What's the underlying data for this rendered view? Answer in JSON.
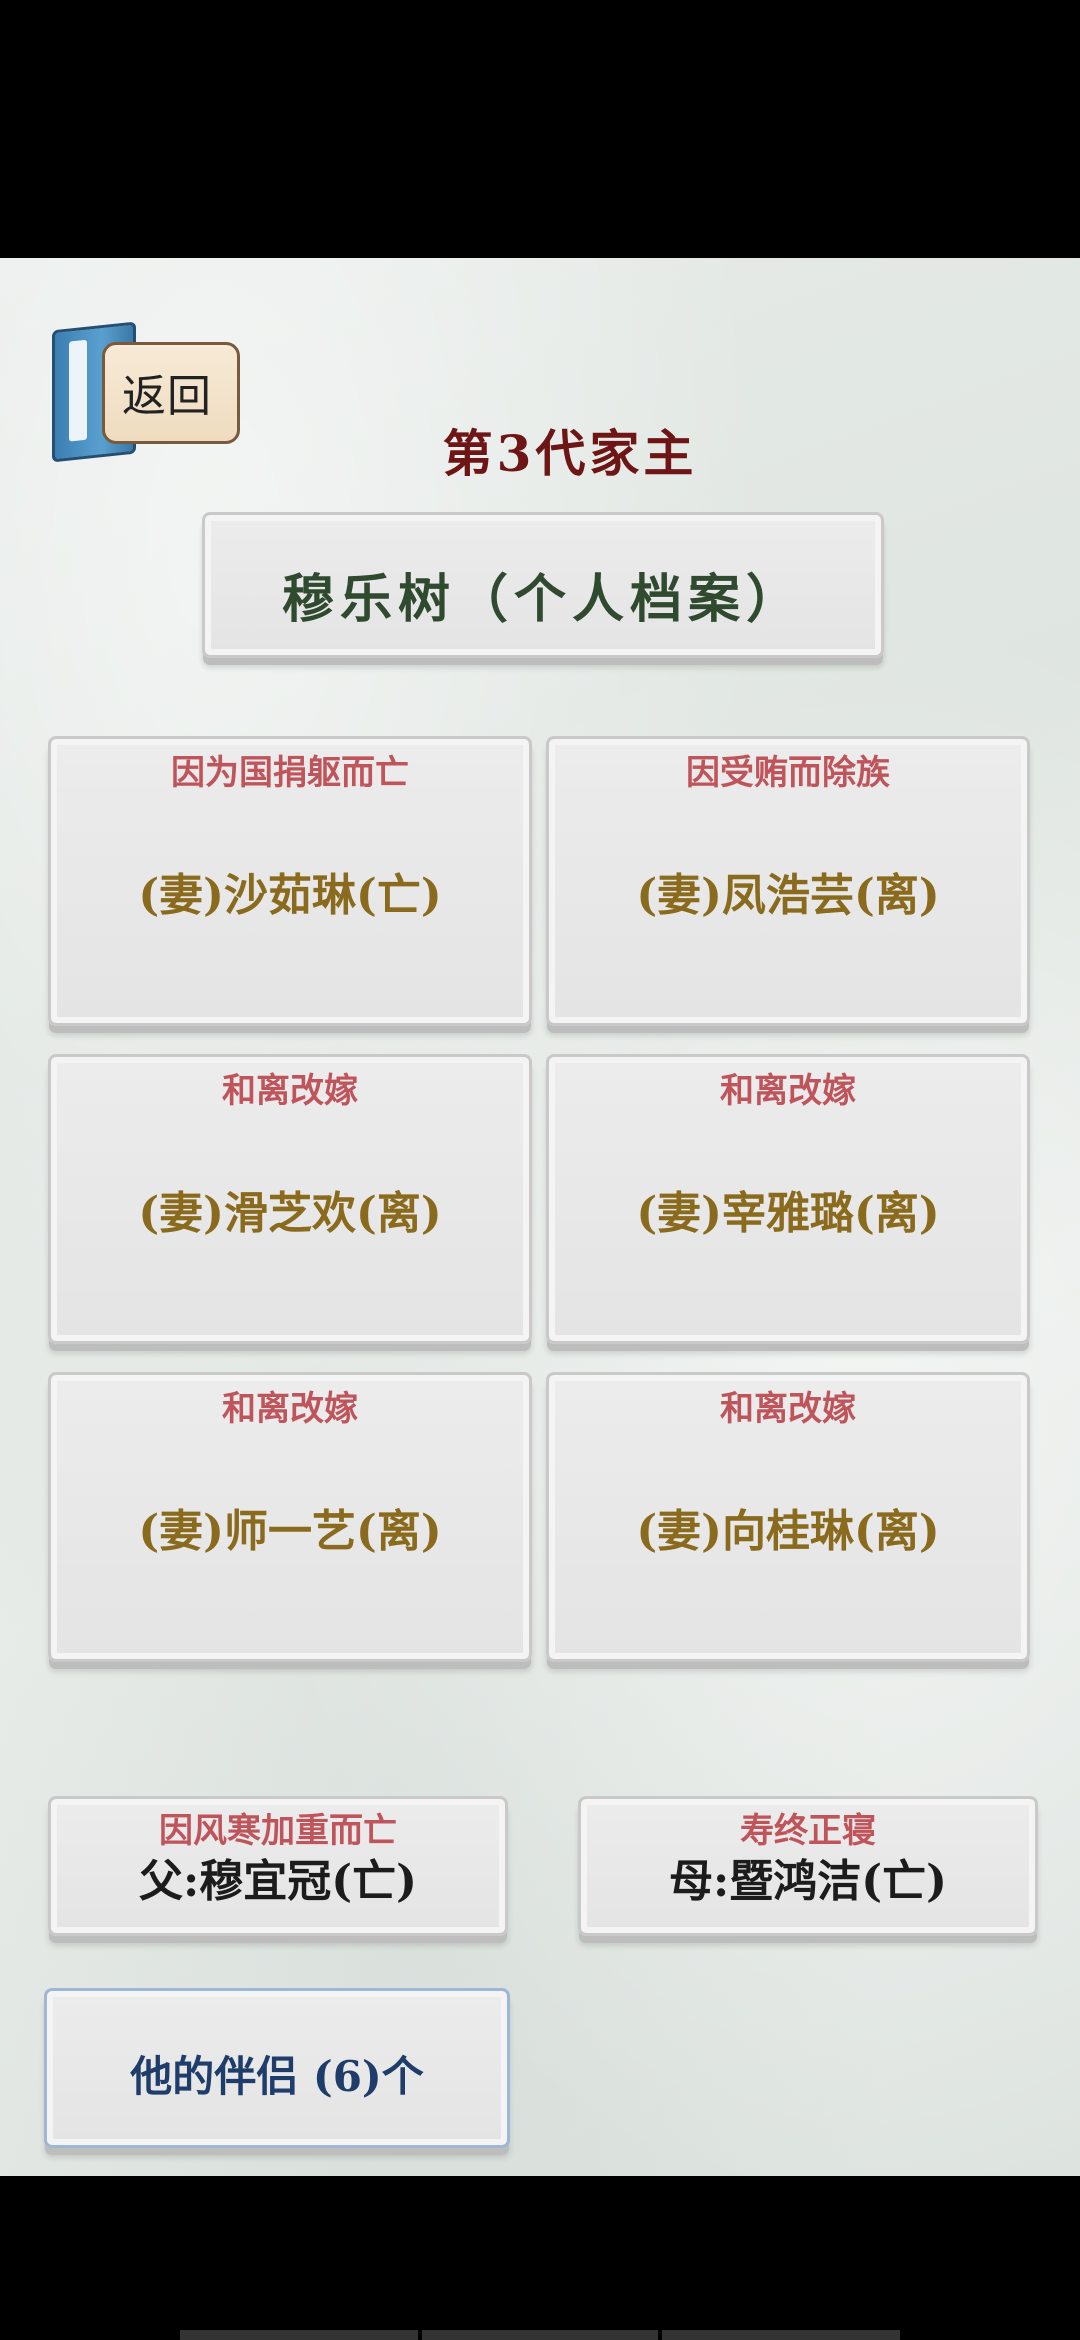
{
  "header": {
    "back_label": "返回",
    "generation_title": "第3代家主"
  },
  "profile": {
    "name_title": "穆乐树（个人档案）"
  },
  "spouses": [
    {
      "reason": "因为国捐躯而亡",
      "name": "(妻)沙茹琳(亡)"
    },
    {
      "reason": "因受贿而除族",
      "name": "(妻)凤浩芸(离)"
    },
    {
      "reason": "和离改嫁",
      "name": "(妻)滑芝欢(离)"
    },
    {
      "reason": "和离改嫁",
      "name": "(妻)宰雅璐(离)"
    },
    {
      "reason": "和离改嫁",
      "name": "(妻)师一艺(离)"
    },
    {
      "reason": "和离改嫁",
      "name": "(妻)向桂琳(离)"
    }
  ],
  "parents": {
    "father": {
      "reason": "因风寒加重而亡",
      "name": "父:穆宜冠(亡)"
    },
    "mother": {
      "reason": "寿终正寝",
      "name": "母:暨鸿洁(亡)"
    }
  },
  "partners_button": {
    "label": "他的伴侣 (6)个"
  },
  "colors": {
    "reason": "#c0545b",
    "spouse_name": "#8a6a1c",
    "title": "#6e1616",
    "profile_name": "#2f4a2f",
    "button_text": "#1f3d6b"
  }
}
